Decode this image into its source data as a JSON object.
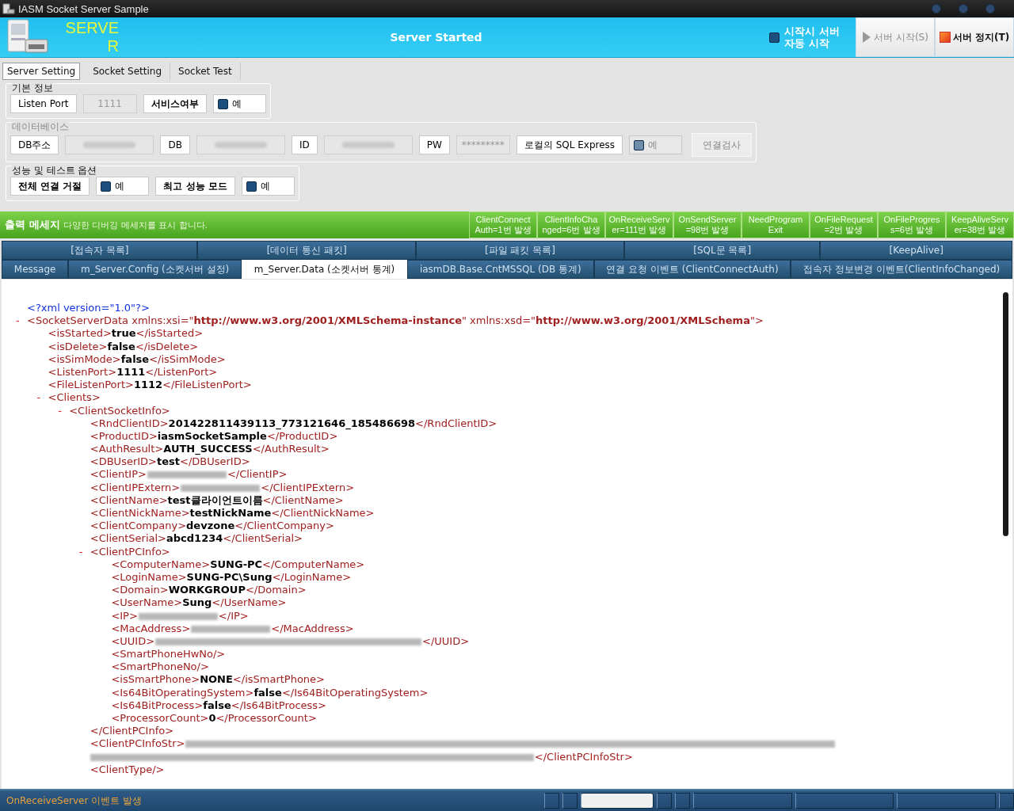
{
  "window": {
    "title": "IASM Socket Server Sample"
  },
  "banner": {
    "logo_text": "SERVER",
    "status": "Server Started",
    "auto_start": {
      "label": "시작시 서버 자동 시작",
      "checked": false
    },
    "buttons": [
      {
        "kind": "start",
        "label": "서버 시작(S)",
        "disabled": true
      },
      {
        "kind": "stop",
        "label": "서버 정지(T)",
        "disabled": false
      }
    ]
  },
  "tabs": [
    {
      "label": "Server Setting",
      "selected": true
    },
    {
      "label": "Socket Setting",
      "selected": false
    },
    {
      "label": "Socket Test",
      "selected": false
    }
  ],
  "groups": [
    {
      "title": "기본 정보",
      "disabled": false,
      "fields": [
        {
          "kind": "label",
          "text": "Listen Port"
        },
        {
          "kind": "value",
          "text": "1111"
        },
        {
          "kind": "label",
          "text": "서비스여부",
          "bold": true
        },
        {
          "kind": "check",
          "label": "예",
          "checked": false
        }
      ]
    },
    {
      "title": "데이터베이스",
      "disabled": true,
      "fields": [
        {
          "kind": "label",
          "text": "DB주소"
        },
        {
          "kind": "redacted"
        },
        {
          "kind": "label",
          "text": "DB"
        },
        {
          "kind": "redacted"
        },
        {
          "kind": "label",
          "text": "ID"
        },
        {
          "kind": "redacted"
        },
        {
          "kind": "label",
          "text": "PW"
        },
        {
          "kind": "value",
          "text": "*********"
        },
        {
          "kind": "label",
          "text": "로컬의 SQL Express"
        },
        {
          "kind": "check",
          "label": "예",
          "checked": false
        },
        {
          "kind": "button",
          "label": "연결검사"
        }
      ]
    },
    {
      "title": "성능 및 테스트 옵션",
      "disabled": false,
      "fields": [
        {
          "kind": "label",
          "text": "전체 연결 거절",
          "bold": true
        },
        {
          "kind": "check",
          "label": "예",
          "checked": false
        },
        {
          "kind": "label",
          "text": "최고 성능 모드",
          "bold": true
        },
        {
          "kind": "check",
          "label": "예",
          "checked": false
        }
      ]
    }
  ],
  "output": {
    "title": "출력 메세지",
    "description": "다양한 디버깅 메세지를 표시 합니다.",
    "counters": [
      {
        "lines": [
          "ClientConnect",
          "Auth=1번 발생"
        ]
      },
      {
        "lines": [
          "ClientInfoCha",
          "nged=6번 발생"
        ]
      },
      {
        "lines": [
          "OnReceiveServ",
          "er=111번 발생"
        ]
      },
      {
        "lines": [
          "OnSendServer",
          "=98번 발생"
        ]
      },
      {
        "lines": [
          "NeedProgram",
          "Exit"
        ]
      },
      {
        "lines": [
          "OnFileRequest",
          "=2번 발생"
        ]
      },
      {
        "lines": [
          "OnFileProgres",
          "s=6번 발생"
        ]
      },
      {
        "lines": [
          "KeepAliveServ",
          "er=38번 발생"
        ]
      }
    ]
  },
  "category_tabs": [
    {
      "label": "[접속자 목록]",
      "selected": false
    },
    {
      "label": "[데이터 통신 패킷]",
      "selected": false
    },
    {
      "label": "[파일 패킷 목록]",
      "selected": false
    },
    {
      "label": "[SQL문 목록]",
      "selected": false
    },
    {
      "label": "[KeepAlive]",
      "selected": false
    }
  ],
  "view_tabs": [
    {
      "label": "Message",
      "selected": false
    },
    {
      "label": "m_Server.Config (소켓서버 설정)",
      "selected": false
    },
    {
      "label": "m_Server.Data  (소켓서버 통계)",
      "selected": true
    },
    {
      "label": "iasmDB.Base.CntMSSQL  (DB 통계)",
      "selected": false
    },
    {
      "label": "연결 요청 이벤트 (ClientConnectAuth)",
      "selected": false
    },
    {
      "label": "접속자 정보변경 이벤트(ClientInfoChanged)",
      "selected": false
    }
  ],
  "xml": [
    {
      "kind": "decl",
      "open": "<?xml version=\"1.0\"?>"
    },
    {
      "kind": "container",
      "toggle": "-",
      "open": "<SocketServerData xmlns:xsi=\"**http://www.w3.org/2001/XMLSchema-instance**\" xmlns:xsd=\"**http://www.w3.org/2001/XMLSchema**\">",
      "children": [
        {
          "kind": "text",
          "open": "<isStarted>",
          "value": "true",
          "close": "</isStarted>"
        },
        {
          "kind": "text",
          "open": "<isDelete>",
          "value": "false",
          "close": "</isDelete>"
        },
        {
          "kind": "text",
          "open": "<isSimMode>",
          "value": "false",
          "close": "</isSimMode>"
        },
        {
          "kind": "text",
          "open": "<ListenPort>",
          "value": "1111",
          "close": "</ListenPort>"
        },
        {
          "kind": "text",
          "open": "<FileListenPort>",
          "value": "1112",
          "close": "</FileListenPort>"
        },
        {
          "kind": "container",
          "toggle": "-",
          "open": "<Clients>",
          "children": [
            {
              "kind": "container",
              "toggle": "-",
              "open": "<ClientSocketInfo>",
              "children": [
                {
                  "kind": "text",
                  "open": "<RndClientID>",
                  "value": "201422811439113_773121646_185486698",
                  "close": "</RndClientID>"
                },
                {
                  "kind": "text",
                  "open": "<ProductID>",
                  "value": "iasmSocketSample",
                  "close": "</ProductID>"
                },
                {
                  "kind": "text",
                  "open": "<AuthResult>",
                  "value": "AUTH_SUCCESS",
                  "close": "</AuthResult>"
                },
                {
                  "kind": "text",
                  "open": "<DBUserID>",
                  "value": "test",
                  "close": "</DBUserID>"
                },
                {
                  "kind": "redacted",
                  "open": "<ClientIP>",
                  "close": "</ClientIP>"
                },
                {
                  "kind": "redacted",
                  "open": "<ClientIPExtern>",
                  "close": "</ClientIPExtern>"
                },
                {
                  "kind": "text",
                  "open": "<ClientName>",
                  "value": "test클라이언트이름",
                  "close": "</ClientName>"
                },
                {
                  "kind": "text",
                  "open": "<ClientNickName>",
                  "value": "testNickName",
                  "close": "</ClientNickName>"
                },
                {
                  "kind": "text",
                  "open": "<ClientCompany>",
                  "value": "devzone",
                  "close": "</ClientCompany>"
                },
                {
                  "kind": "text",
                  "open": "<ClientSerial>",
                  "value": "abcd1234",
                  "close": "</ClientSerial>"
                },
                {
                  "kind": "container",
                  "toggle": "-",
                  "open": "<ClientPCInfo>",
                  "close": "</ClientPCInfo>",
                  "children": [
                    {
                      "kind": "text",
                      "open": "<ComputerName>",
                      "value": "SUNG-PC",
                      "close": "</ComputerName>"
                    },
                    {
                      "kind": "text",
                      "open": "<LoginName>",
                      "value": "SUNG-PC\\Sung",
                      "close": "</LoginName>"
                    },
                    {
                      "kind": "text",
                      "open": "<Domain>",
                      "value": "WORKGROUP",
                      "close": "</Domain>"
                    },
                    {
                      "kind": "text",
                      "open": "<UserName>",
                      "value": "Sung",
                      "close": "</UserName>"
                    },
                    {
                      "kind": "redacted",
                      "open": "<IP>",
                      "close": "</IP>"
                    },
                    {
                      "kind": "redacted",
                      "open": "<MacAddress>",
                      "close": "</MacAddress>"
                    },
                    {
                      "kind": "redacted_long",
                      "open": "<UUID>",
                      "close": "</UUID>"
                    },
                    {
                      "kind": "empty",
                      "open": "<SmartPhoneHwNo/>"
                    },
                    {
                      "kind": "empty",
                      "open": "<SmartPhoneNo/>"
                    },
                    {
                      "kind": "text",
                      "open": "<isSmartPhone>",
                      "value": "NONE",
                      "close": "</isSmartPhone>"
                    },
                    {
                      "kind": "text",
                      "open": "<Is64BitOperatingSystem>",
                      "value": "false",
                      "close": "</Is64BitOperatingSystem>"
                    },
                    {
                      "kind": "text",
                      "open": "<Is64BitProcess>",
                      "value": "false",
                      "close": "</Is64BitProcess>"
                    },
                    {
                      "kind": "text",
                      "open": "<ProcessorCount>",
                      "value": "0",
                      "close": "</ProcessorCount>"
                    }
                  ]
                },
                {
                  "kind": "redacted_wrap",
                  "open": "<ClientPCInfoStr>",
                  "close": "</ClientPCInfoStr>"
                },
                {
                  "kind": "empty",
                  "open": "<ClientType/>"
                }
              ]
            }
          ]
        }
      ]
    }
  ],
  "status_bar": {
    "message": "OnReceiveServer 이벤트 발생"
  }
}
